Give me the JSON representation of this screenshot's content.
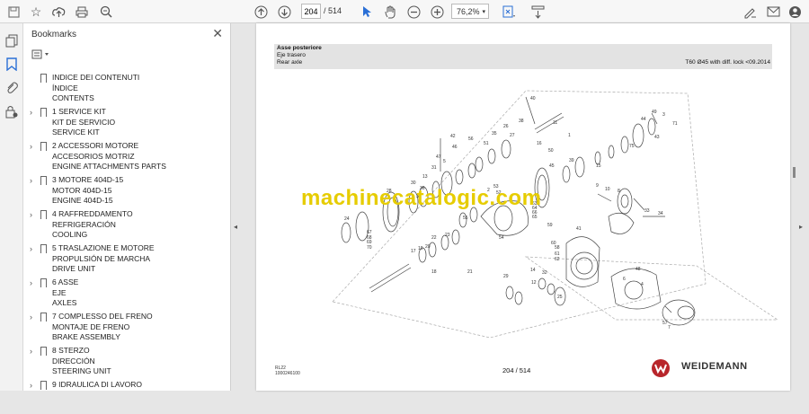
{
  "toolbar": {
    "icons": [
      "save-icon",
      "star-icon",
      "upload-icon",
      "print-icon",
      "zoom-out-search-icon",
      "page-up-icon",
      "page-down-icon",
      "pointer-icon",
      "hand-icon",
      "zoom-out-icon",
      "zoom-in-icon",
      "fit-page-icon",
      "scroll-mode-icon",
      "sign-icon",
      "mail-icon",
      "account-icon"
    ],
    "page_current": "204",
    "page_total": "/ 514",
    "zoom": "76,2%"
  },
  "bookmarks": {
    "title": "Bookmarks",
    "close": "✕",
    "items": [
      {
        "lines": [
          "INDICE DEI CONTENUTI",
          "ÍNDICE",
          "CONTENTS"
        ],
        "expandable": false
      },
      {
        "lines": [
          "1 SERVICE KIT",
          "KIT DE SERVICIO",
          "SERVICE KIT"
        ],
        "expandable": true
      },
      {
        "lines": [
          "2 ACCESSORI MOTORE",
          "ACCESORIOS MOTRIZ",
          "ENGINE ATTACHMENTS PARTS"
        ],
        "expandable": true
      },
      {
        "lines": [
          "3 MOTORE 404D-15",
          "MOTOR 404D-15",
          "ENGINE 404D-15"
        ],
        "expandable": true
      },
      {
        "lines": [
          "4 RAFFREDDAMENTO",
          "REFRIGERACIÓN",
          "COOLING"
        ],
        "expandable": true
      },
      {
        "lines": [
          "5 TRASLAZIONE E MOTORE",
          "PROPULSIÓN DE MARCHA",
          "DRIVE UNIT"
        ],
        "expandable": true
      },
      {
        "lines": [
          "6 ASSE",
          "EJE",
          "AXLES"
        ],
        "expandable": true
      },
      {
        "lines": [
          "7 COMPLESSO DEL FRENO",
          "MONTAJE DE FRENO",
          "BRAKE ASSEMBLY"
        ],
        "expandable": true
      },
      {
        "lines": [
          "8 STERZO",
          "DIRECCIÓN",
          "STEERING UNIT"
        ],
        "expandable": true
      },
      {
        "lines": [
          "9 IDRAULICA DI LAVORO"
        ],
        "expandable": true
      }
    ]
  },
  "document": {
    "header_lines": [
      "Asse posteriore",
      "Eje trasero",
      "Rear axle"
    ],
    "header_right": "T60 Ø45 with diff. lock <09.2014",
    "watermark": "machinecatalogic.com",
    "footer_code1": "RL22",
    "footer_code2": "1000246100",
    "footer_page": "204 / 514",
    "brand": "WEIDEMANN",
    "callouts": [
      "40",
      "42",
      "47",
      "46",
      "11",
      "38",
      "44",
      "43",
      "49",
      "3",
      "71",
      "75",
      "15",
      "50",
      "1",
      "16",
      "51",
      "30",
      "31",
      "5",
      "56",
      "35",
      "26",
      "27",
      "13",
      "36",
      "28",
      "37",
      "45",
      "39",
      "53",
      "2",
      "52",
      "63",
      "64",
      "66",
      "65",
      "59",
      "60",
      "58",
      "61",
      "62",
      "55",
      "54",
      "9",
      "10",
      "8",
      "41",
      "34",
      "33",
      "21",
      "22",
      "23",
      "17",
      "18",
      "19",
      "20",
      "29",
      "14",
      "12",
      "24",
      "67",
      "68",
      "69",
      "70",
      "57",
      "48",
      "25",
      "32",
      "4",
      "6",
      "7"
    ]
  },
  "colors": {
    "accent": "#e6cc00",
    "brand": "#b8262b"
  }
}
